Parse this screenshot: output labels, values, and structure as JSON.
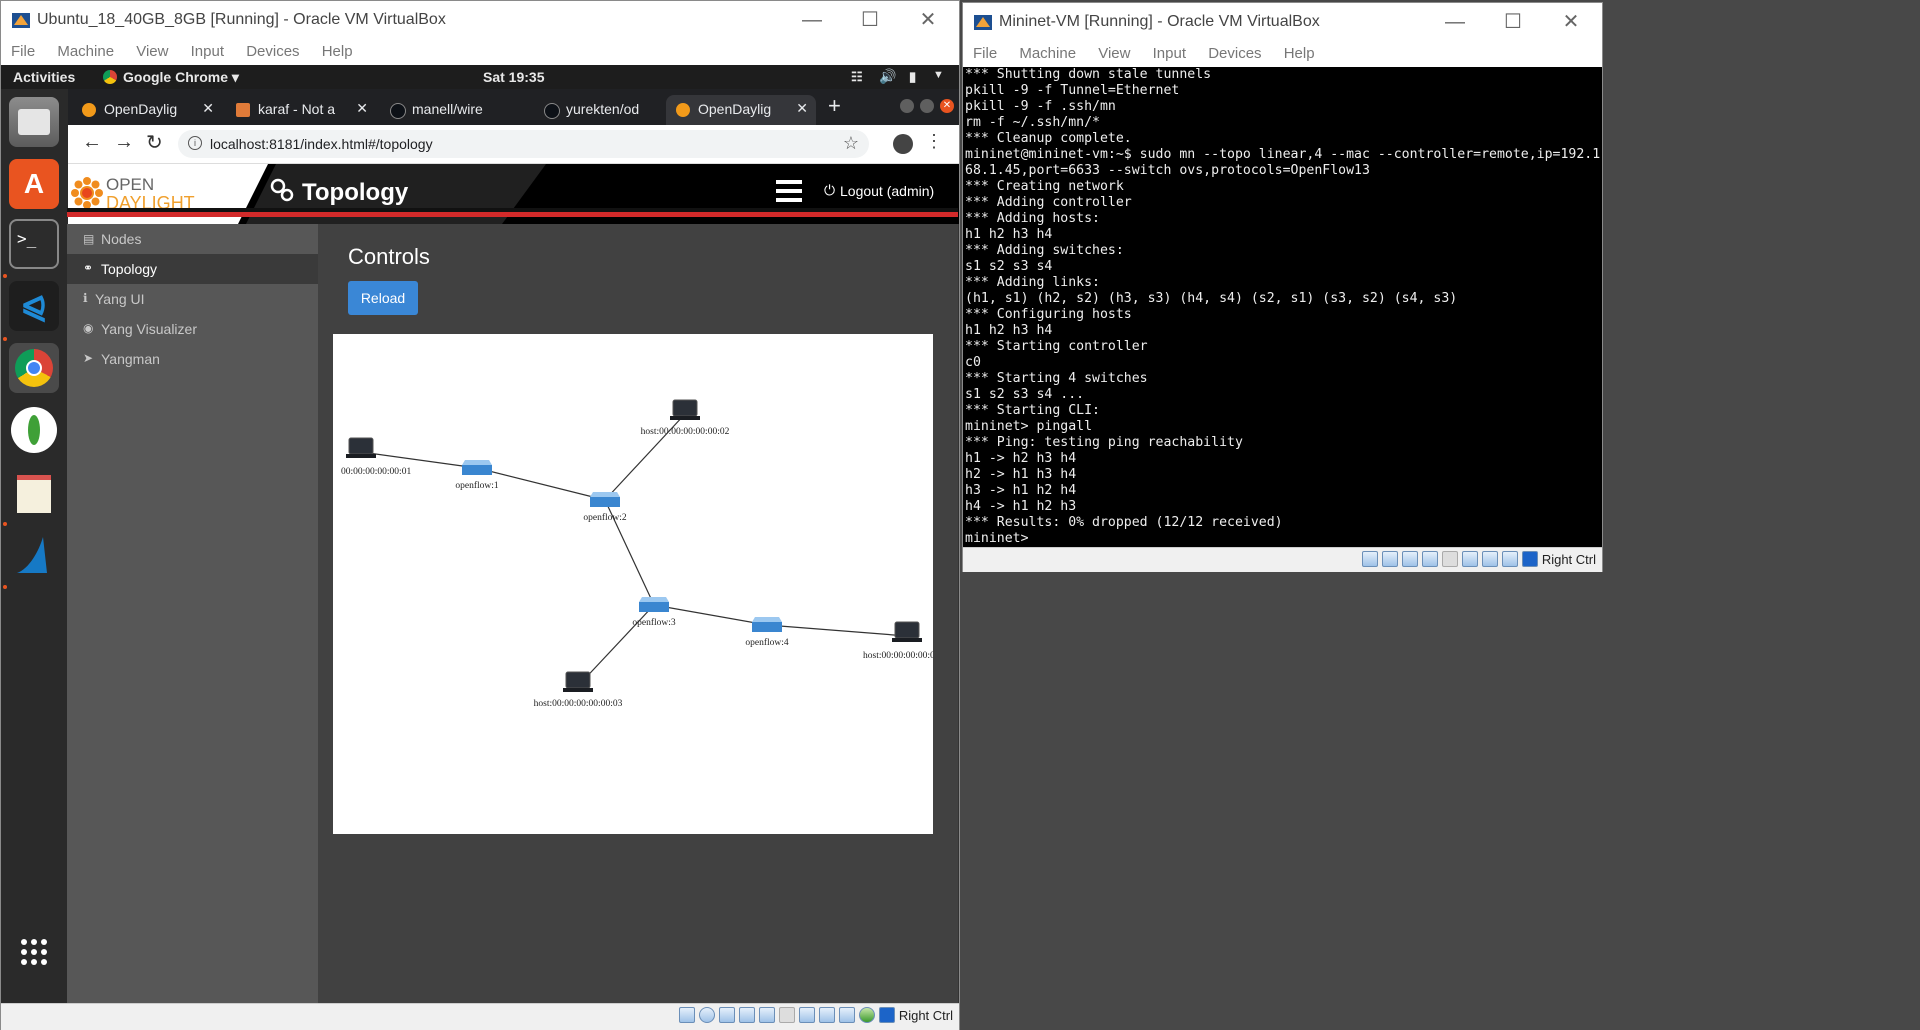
{
  "left_window": {
    "title": "Ubuntu_18_40GB_8GB [Running] - Oracle VM VirtualBox",
    "menu": [
      "File",
      "Machine",
      "View",
      "Input",
      "Devices",
      "Help"
    ],
    "status_label": "Right Ctrl"
  },
  "ubuntu": {
    "activities": "Activities",
    "app_menu": "Google Chrome ▾",
    "clock": "Sat 19:35"
  },
  "chrome": {
    "tabs": [
      {
        "title": "OpenDaylig",
        "color": "#f29a1a"
      },
      {
        "title": "karaf - Not a",
        "color": "#e07b39"
      },
      {
        "title": "manell/wire",
        "color": "#ffffff"
      },
      {
        "title": "yurekten/od",
        "color": "#ffffff"
      },
      {
        "title": "OpenDaylig",
        "color": "#f29a1a"
      }
    ],
    "new_tab": "+",
    "url": "localhost:8181/index.html#/topology"
  },
  "odl": {
    "logo_top": "OPEN",
    "logo_bottom": "DAYLIGHT",
    "page_title": "Topology",
    "logout": "Logout (admin)",
    "sidebar": [
      {
        "label": "Nodes",
        "icon": "sitemap-icon"
      },
      {
        "label": "Topology",
        "icon": "link-icon"
      },
      {
        "label": "Yang UI",
        "icon": "info-icon"
      },
      {
        "label": "Yang Visualizer",
        "icon": "eye-icon"
      },
      {
        "label": "Yangman",
        "icon": "rocket-icon"
      }
    ],
    "controls_title": "Controls",
    "reload": "Reload"
  },
  "topology": {
    "nodes": [
      {
        "id": "h1",
        "label": "00:00:00:00:00:01",
        "kind": "host"
      },
      {
        "id": "s1",
        "label": "openflow:1",
        "kind": "switch"
      },
      {
        "id": "h2",
        "label": "host:00:00:00:00:00:02",
        "kind": "host"
      },
      {
        "id": "s2",
        "label": "openflow:2",
        "kind": "switch"
      },
      {
        "id": "s3",
        "label": "openflow:3",
        "kind": "switch"
      },
      {
        "id": "s4",
        "label": "openflow:4",
        "kind": "switch"
      },
      {
        "id": "h4",
        "label": "host:00:00:00:00:00:0",
        "kind": "host"
      },
      {
        "id": "h3",
        "label": "host:00:00:00:00:00:03",
        "kind": "host"
      }
    ],
    "links": [
      [
        "h1",
        "s1"
      ],
      [
        "s1",
        "s2"
      ],
      [
        "s2",
        "h2"
      ],
      [
        "s2",
        "s3"
      ],
      [
        "s3",
        "s4"
      ],
      [
        "s4",
        "h4"
      ],
      [
        "s3",
        "h3"
      ]
    ]
  },
  "right_window": {
    "title": "Mininet-VM [Running] - Oracle VM VirtualBox",
    "menu": [
      "File",
      "Machine",
      "View",
      "Input",
      "Devices",
      "Help"
    ],
    "status_label": "Right Ctrl",
    "terminal": [
      "*** Shutting down stale tunnels",
      "pkill -9 -f Tunnel=Ethernet",
      "pkill -9 -f .ssh/mn",
      "rm -f ~/.ssh/mn/*",
      "*** Cleanup complete.",
      "mininet@mininet-vm:~$ sudo mn --topo linear,4 --mac --controller=remote,ip=192.1",
      "68.1.45,port=6633 --switch ovs,protocols=OpenFlow13",
      "*** Creating network",
      "*** Adding controller",
      "*** Adding hosts:",
      "h1 h2 h3 h4",
      "*** Adding switches:",
      "s1 s2 s3 s4",
      "*** Adding links:",
      "(h1, s1) (h2, s2) (h3, s3) (h4, s4) (s2, s1) (s3, s2) (s4, s3)",
      "*** Configuring hosts",
      "h1 h2 h3 h4",
      "*** Starting controller",
      "c0",
      "*** Starting 4 switches",
      "s1 s2 s3 s4 ...",
      "*** Starting CLI:",
      "mininet> pingall",
      "*** Ping: testing ping reachability",
      "h1 -> h2 h3 h4",
      "h2 -> h1 h3 h4",
      "h3 -> h1 h2 h4",
      "h4 -> h1 h2 h3",
      "*** Results: 0% dropped (12/12 received)",
      "mininet>"
    ]
  }
}
